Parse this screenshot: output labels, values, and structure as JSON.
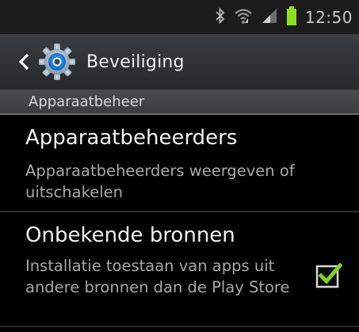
{
  "status_bar": {
    "time": "12:50",
    "icons": [
      "bluetooth-icon",
      "wifi-icon",
      "signal-icon",
      "battery-icon"
    ],
    "battery_color": "#8fe01f"
  },
  "action_bar": {
    "title": "Beveiliging",
    "back_icon": "chevron-left-icon",
    "app_icon": "settings-gear-icon"
  },
  "section": {
    "header": "Apparaatbeheer"
  },
  "items": [
    {
      "title": "Apparaatbeheerders",
      "summary": "Apparaatbeheerders weergeven of uitschakelen"
    },
    {
      "title": "Onbekende bronnen",
      "summary": "Installatie toestaan van apps uit andere bronnen dan de Play Store",
      "checked": true
    }
  ],
  "colors": {
    "check_green": "#7ed321",
    "background": "#000000"
  }
}
